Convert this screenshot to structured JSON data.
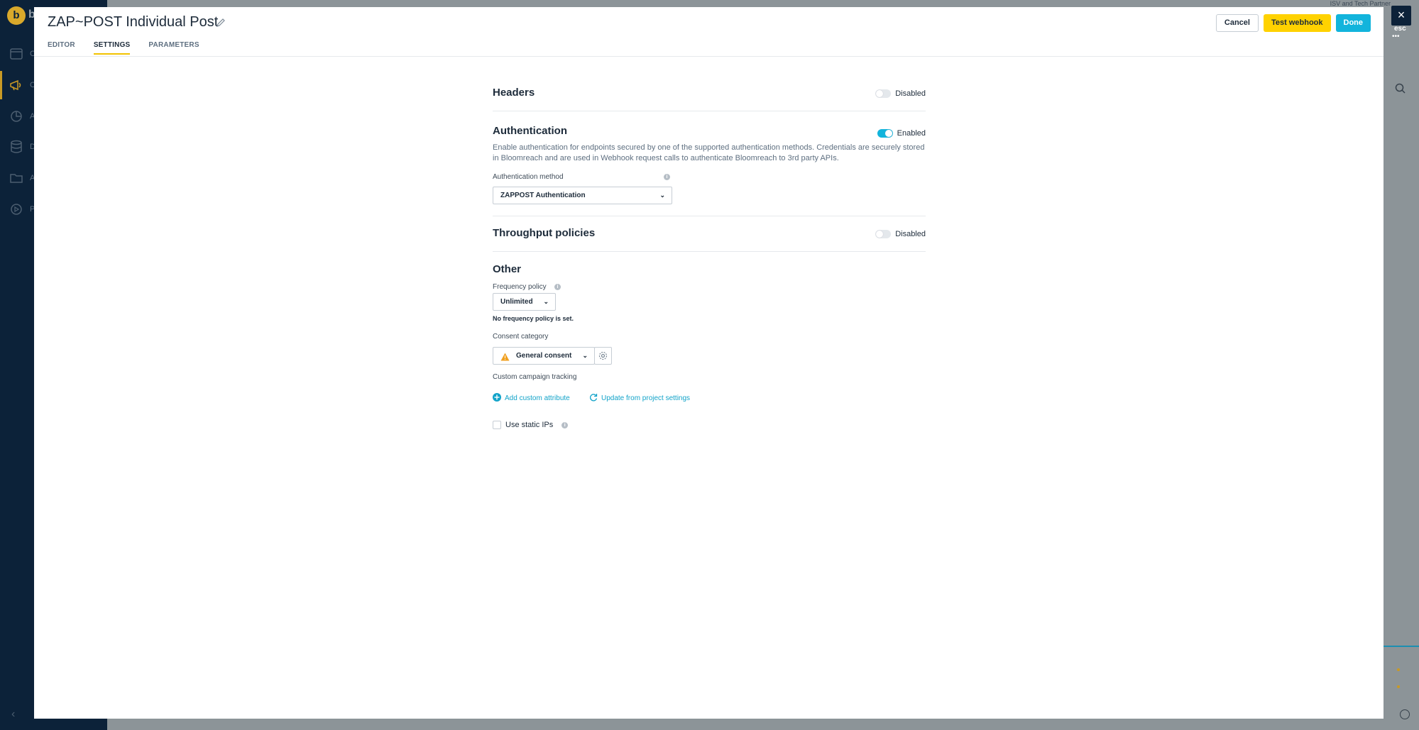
{
  "background": {
    "logo_letter": "b",
    "logo_rest": "b",
    "sidebar_letters": [
      "C",
      "C",
      "A",
      "D",
      "A",
      "P"
    ],
    "top_right_text": "ISV and Tech Partner",
    "esc_label": "esc",
    "esc_dots": "•••"
  },
  "modal": {
    "title": "ZAP~POST Individual Post",
    "tabs": [
      {
        "label": "EDITOR"
      },
      {
        "label": "SETTINGS"
      },
      {
        "label": "PARAMETERS"
      }
    ],
    "buttons": {
      "cancel": "Cancel",
      "test": "Test webhook",
      "done": "Done"
    }
  },
  "settings": {
    "headers": {
      "title": "Headers",
      "status": "Disabled"
    },
    "authentication": {
      "title": "Authentication",
      "status": "Enabled",
      "description": "Enable authentication for endpoints secured by one of the supported authentication methods. Credentials are securely stored in Bloomreach and are used in Webhook request calls to authenticate Bloomreach to 3rd party APIs.",
      "method_label": "Authentication method",
      "method_value": "ZAPPOST Authentication"
    },
    "throughput": {
      "title": "Throughput policies",
      "status": "Disabled"
    },
    "other": {
      "title": "Other",
      "frequency_label": "Frequency policy",
      "frequency_value": "Unlimited",
      "frequency_note": "No frequency policy is set.",
      "consent_label": "Consent category",
      "consent_value": "General consent",
      "tracking_label": "Custom campaign tracking",
      "add_attribute": "Add custom attribute",
      "update_from_project": "Update from project settings",
      "static_ips_label": "Use static IPs"
    }
  },
  "colors": {
    "accent": "#12b4dc",
    "primary_button": "#ffd200",
    "warning": "#f0a020",
    "sidebar": "#0c2239"
  }
}
